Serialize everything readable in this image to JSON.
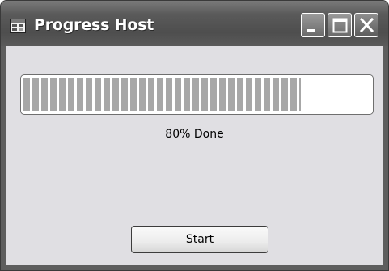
{
  "window": {
    "title": "Progress Host",
    "icon": "app-window-icon",
    "controls": {
      "minimize_icon": "minimize-icon",
      "maximize_icon": "maximize-icon",
      "close_icon": "close-icon"
    }
  },
  "progress": {
    "value_percent": 80,
    "label": "80% Done",
    "fill_color": "#a7a7a7"
  },
  "actions": {
    "start_label": "Start"
  },
  "colors": {
    "titlebar": "#5a5a5a",
    "client_background": "#e0dfe3"
  }
}
